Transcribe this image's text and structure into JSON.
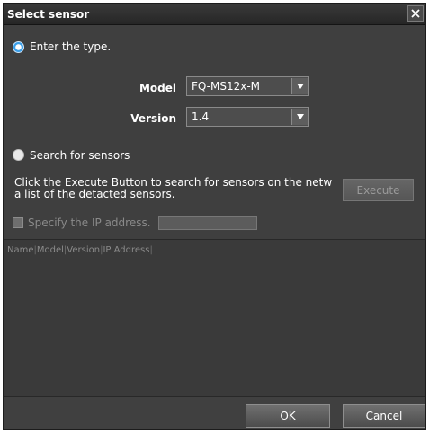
{
  "dialog": {
    "title": "Select sensor"
  },
  "enter_type": {
    "label": "Enter the type.",
    "selected": true,
    "model_label": "Model",
    "model_value": "FQ-MS12x-M",
    "version_label": "Version",
    "version_value": "1.4"
  },
  "search": {
    "label": "Search for sensors",
    "selected": false,
    "description_line1": "Click the Execute Button to search for sensors on the netw",
    "description_line2": "a list of the detacted sensors.",
    "execute_label": "Execute",
    "specify_ip_label": "Specify the IP address.",
    "ip_value": ""
  },
  "sensor_list": {
    "columns": [
      "Name",
      "Model",
      "Version",
      "IP Address"
    ]
  },
  "footer": {
    "ok_label": "OK",
    "cancel_label": "Cancel"
  },
  "icons": {
    "close": "close-icon",
    "dropdown": "triangle-down-icon"
  },
  "colors": {
    "accent": "#3a9ee8",
    "background": "#3f3f3f"
  }
}
